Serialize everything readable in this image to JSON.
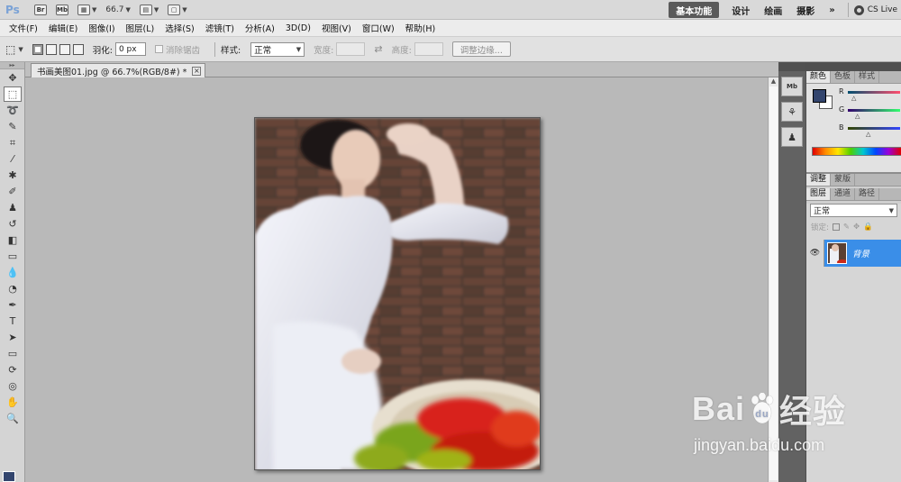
{
  "appbar": {
    "logo": "Ps",
    "bridge_label": "Br",
    "minibridge_label": "Mb",
    "zoom": "66.7",
    "workspaces": [
      "基本功能",
      "设计",
      "绘画",
      "摄影"
    ],
    "more": "»",
    "cs_live": "CS Live"
  },
  "menu": [
    "文件(F)",
    "编辑(E)",
    "图像(I)",
    "图层(L)",
    "选择(S)",
    "滤镜(T)",
    "分析(A)",
    "3D(D)",
    "视图(V)",
    "窗口(W)",
    "帮助(H)"
  ],
  "options": {
    "feather_label": "羽化:",
    "feather_value": "0 px",
    "antialias_label": "消除锯齿",
    "style_label": "样式:",
    "style_value": "正常",
    "width_label": "宽度:",
    "height_label": "高度:",
    "refine_edge": "调整边缘..."
  },
  "document": {
    "tab_title": "书画美图01.jpg @ 66.7%(RGB/8#) *"
  },
  "panels": {
    "color_tabs": [
      "颜色",
      "色板",
      "样式"
    ],
    "channels": [
      "R",
      "G",
      "B"
    ],
    "foreground_color": "#33456e",
    "adjust_tabs": [
      "调整",
      "蒙版"
    ],
    "layer_tabs": [
      "图层",
      "通道",
      "路径"
    ],
    "blend_mode": "正常",
    "lock_label": "锁定:",
    "layer_name": "背景"
  },
  "watermark": {
    "logo_text_left": "Bai",
    "logo_text_right": "经验",
    "url": "jingyan.baidu.com"
  }
}
